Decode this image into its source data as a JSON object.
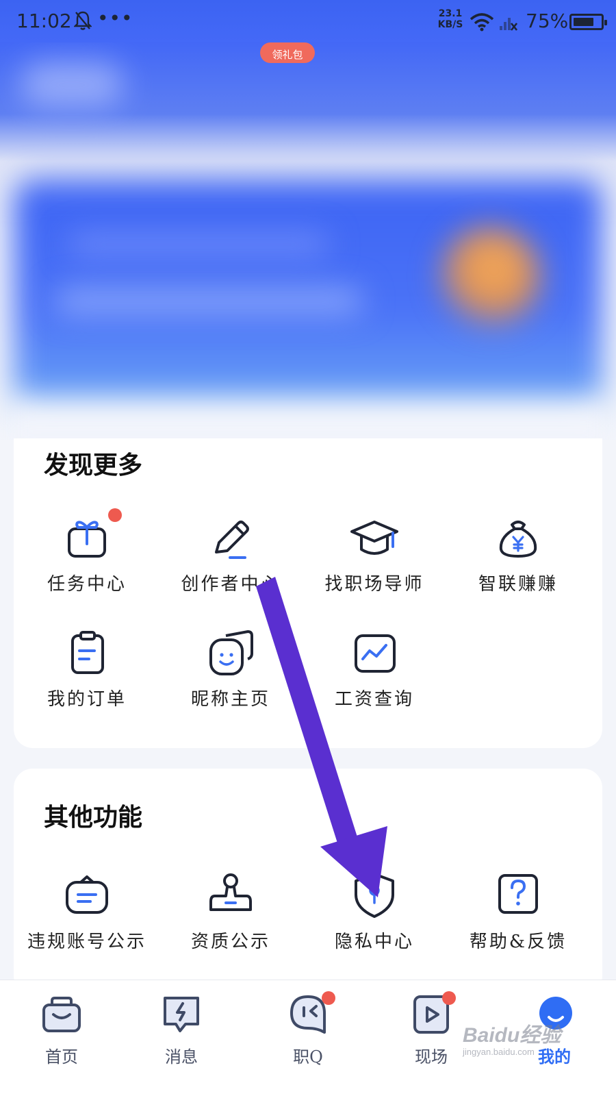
{
  "status_bar": {
    "time": "11:02",
    "dots": "•••",
    "speed_value": "23.1",
    "speed_unit": "KB/S",
    "battery": "75%",
    "battery_level": 0.75
  },
  "header": {
    "gift_label": "领礼包"
  },
  "discover": {
    "title": "发现更多",
    "items": [
      {
        "label": "任务中心",
        "icon": "gift-icon",
        "badge": true
      },
      {
        "label": "创作者中心",
        "icon": "pencil-icon",
        "badge": false
      },
      {
        "label": "找职场导师",
        "icon": "graduation-cap-icon",
        "badge": false
      },
      {
        "label": "智联赚赚",
        "icon": "money-bag-icon",
        "badge": false
      },
      {
        "label": "我的订单",
        "icon": "clipboard-icon",
        "badge": false
      },
      {
        "label": "昵称主页",
        "icon": "profile-cards-icon",
        "badge": false
      },
      {
        "label": "工资查询",
        "icon": "salary-chart-icon",
        "badge": false
      }
    ]
  },
  "other": {
    "title": "其他功能",
    "items": [
      {
        "label": "违规账号公示",
        "icon": "notice-bag-icon"
      },
      {
        "label": "资质公示",
        "icon": "stamp-icon"
      },
      {
        "label": "隐私中心",
        "icon": "shield-key-icon"
      },
      {
        "label": "帮助&反馈",
        "icon": "question-icon"
      }
    ]
  },
  "bottom_nav": {
    "items": [
      {
        "label": "首页",
        "icon": "home-bag-icon",
        "badge": false,
        "active": false
      },
      {
        "label": "消息",
        "icon": "message-bolt-icon",
        "badge": false,
        "active": false
      },
      {
        "label": "职Q",
        "icon": "ghost-chat-icon",
        "badge": true,
        "active": false
      },
      {
        "label": "现场",
        "icon": "play-icon",
        "badge": true,
        "active": false
      },
      {
        "label": "我的",
        "icon": "smile-profile-icon",
        "badge": false,
        "active": true
      }
    ]
  },
  "watermark": {
    "main": "Baidu经验",
    "sub": "jingyan.baidu.com"
  },
  "colors": {
    "accent": "#2f6df4",
    "header_blue": "#3c63f2",
    "badge_red": "#ee5a4f",
    "arrow_purple": "#5a2fd0"
  }
}
